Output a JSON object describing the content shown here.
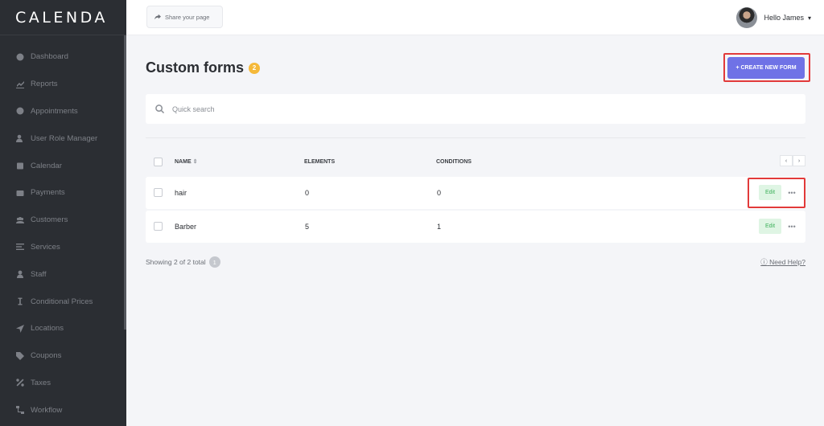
{
  "app": {
    "logo": "CALENDA"
  },
  "sidebar": {
    "items": [
      {
        "label": "Dashboard",
        "icon": "dashboard-icon"
      },
      {
        "label": "Reports",
        "icon": "chart-icon"
      },
      {
        "label": "Appointments",
        "icon": "clock-icon"
      },
      {
        "label": "User Role Manager",
        "icon": "user-plus-icon"
      },
      {
        "label": "Calendar",
        "icon": "calendar-icon"
      },
      {
        "label": "Payments",
        "icon": "wallet-icon"
      },
      {
        "label": "Customers",
        "icon": "users-icon"
      },
      {
        "label": "Services",
        "icon": "list-icon"
      },
      {
        "label": "Staff",
        "icon": "person-icon"
      },
      {
        "label": "Conditional Prices",
        "icon": "price-icon"
      },
      {
        "label": "Locations",
        "icon": "location-arrow-icon"
      },
      {
        "label": "Coupons",
        "icon": "tag-icon"
      },
      {
        "label": "Taxes",
        "icon": "percent-icon"
      },
      {
        "label": "Workflow",
        "icon": "workflow-icon"
      }
    ]
  },
  "topbar": {
    "share_label": "Share your page",
    "user_greeting": "Hello James"
  },
  "page": {
    "title": "Custom forms",
    "count": "2",
    "create_label": "+ CREATE NEW FORM"
  },
  "search": {
    "placeholder": "Quick search"
  },
  "table": {
    "columns": {
      "name": "NAME",
      "sort_icon": "⇕",
      "elements": "ELEMENTS",
      "conditions": "CONDITIONS"
    },
    "rows": [
      {
        "name": "hair",
        "elements": "0",
        "conditions": "0",
        "edit": "Edit"
      },
      {
        "name": "Barber",
        "elements": "5",
        "conditions": "1",
        "edit": "Edit"
      }
    ]
  },
  "footer": {
    "showing": "Showing 2 of 2 total",
    "page": "1",
    "help": "Need Help?"
  },
  "colors": {
    "accent": "#6f72e6",
    "sidebar_bg": "#2b2e33",
    "badge": "#f5b93a",
    "edit_bg": "#dff5e4",
    "highlight": "#e23a3a"
  }
}
